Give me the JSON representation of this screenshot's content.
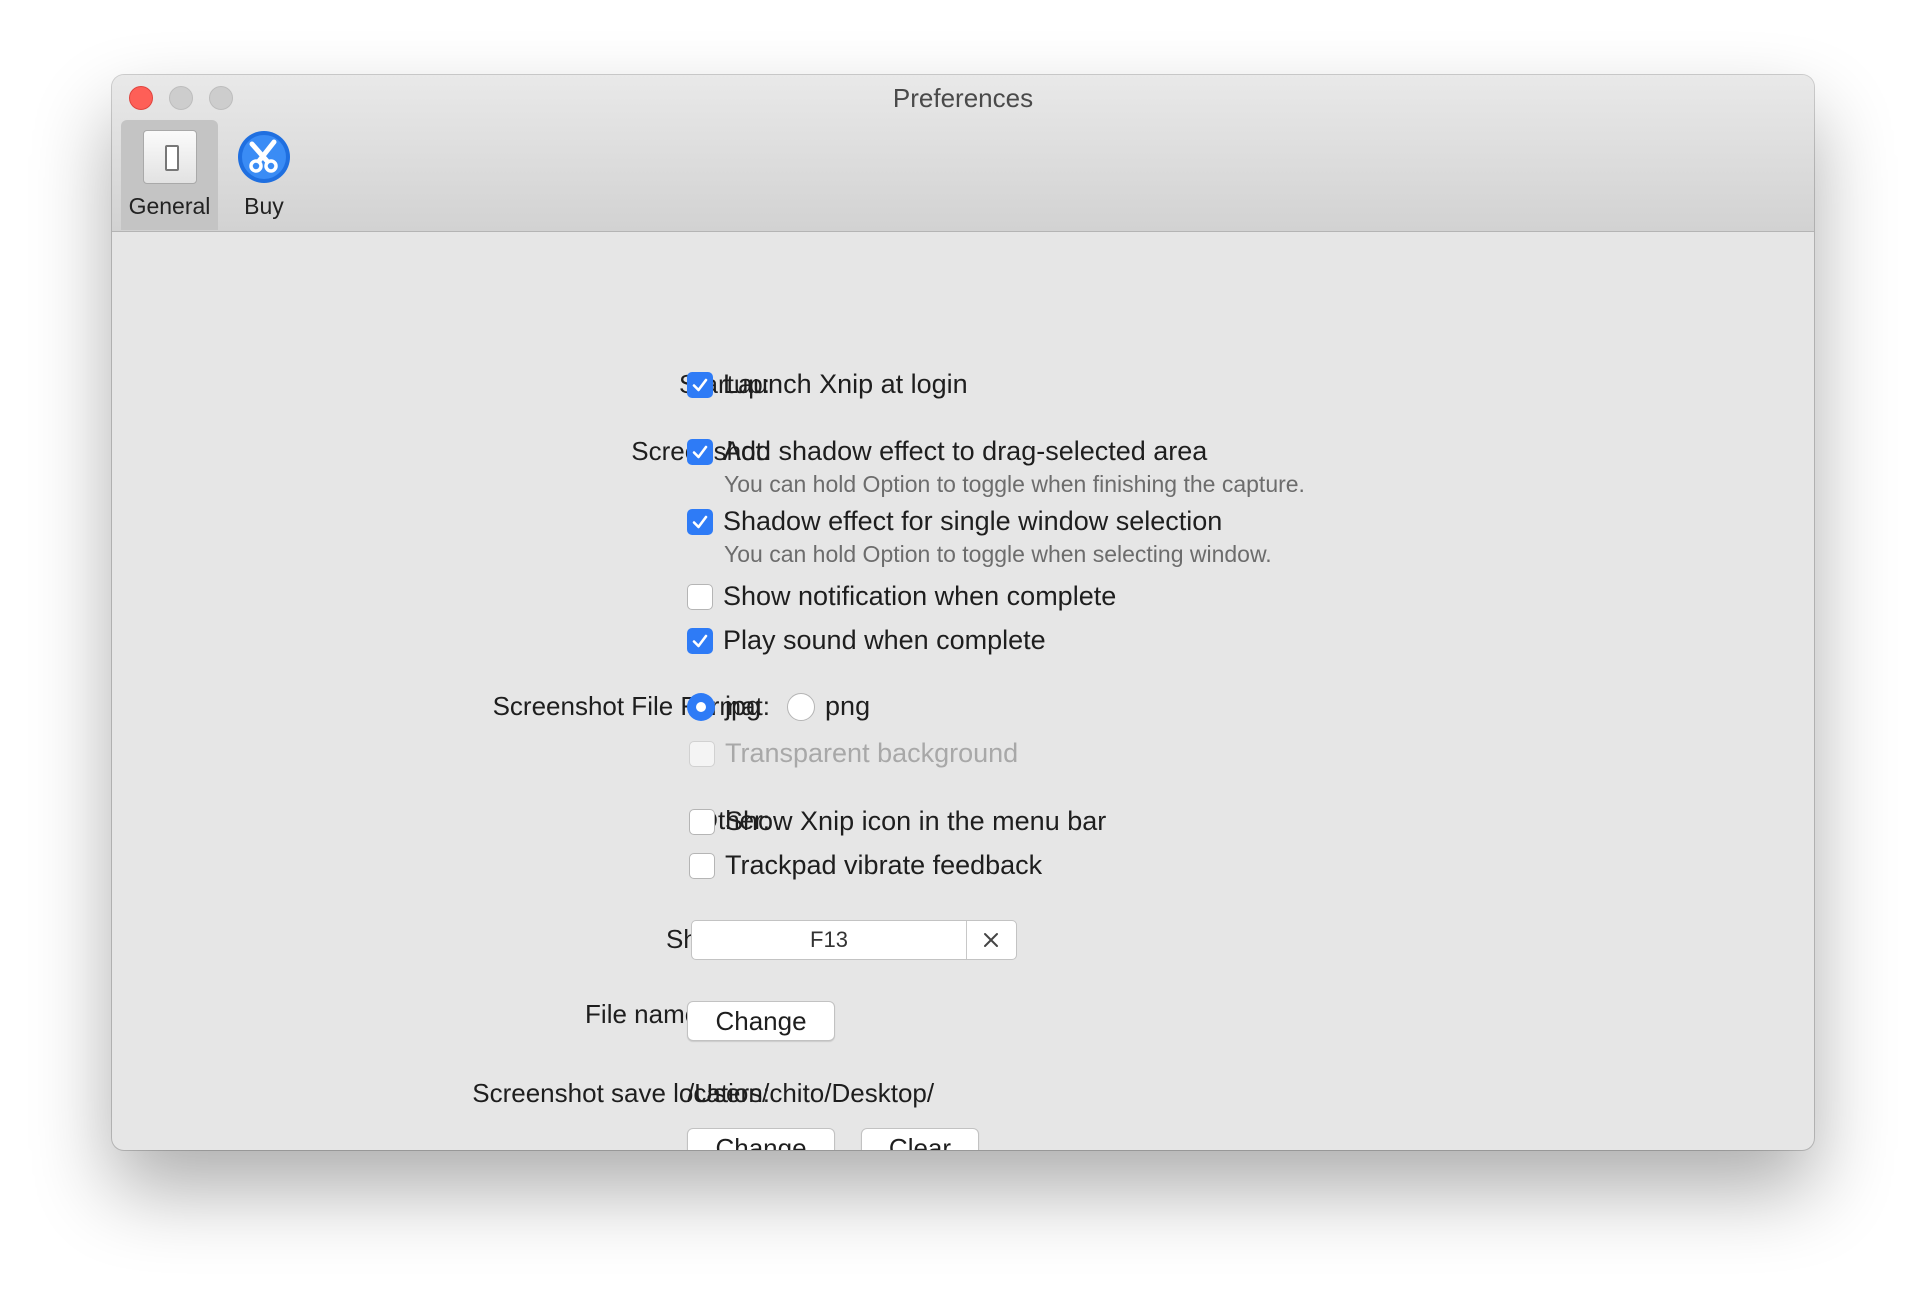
{
  "window": {
    "title": "Preferences",
    "tabs": [
      {
        "label": "General",
        "icon": "switch-icon",
        "selected": true
      },
      {
        "label": "Buy",
        "icon": "xnip-logo-icon",
        "selected": false
      }
    ]
  },
  "startup": {
    "label": "Startup:",
    "launch_at_login": {
      "label": "Launch Xnip at login",
      "checked": true
    }
  },
  "screenshot": {
    "label": "Screenshot:",
    "shadow_drag": {
      "label": "Add shadow effect to drag-selected area",
      "checked": true,
      "hint": "You can hold Option to toggle when finishing the capture."
    },
    "shadow_window": {
      "label": "Shadow effect for single window selection",
      "checked": true,
      "hint": "You can hold Option to toggle when selecting window."
    },
    "show_notification": {
      "label": "Show notification when complete",
      "checked": false
    },
    "play_sound": {
      "label": "Play sound when complete",
      "checked": true
    }
  },
  "file_format": {
    "label": "Screenshot File Format:",
    "options": [
      {
        "label": "jpg",
        "selected": true
      },
      {
        "label": "png",
        "selected": false
      }
    ],
    "transparent_background": {
      "label": "Transparent background",
      "checked": false,
      "enabled": false
    }
  },
  "other": {
    "label": "Other:",
    "menu_bar_icon": {
      "label": "Show Xnip icon in the menu bar",
      "checked": false
    },
    "trackpad_feedback": {
      "label": "Trackpad vibrate feedback",
      "checked": false
    }
  },
  "shortcut": {
    "label": "Shortcut:",
    "value": "F13"
  },
  "file_name_rules": {
    "label": "File name rules:",
    "change_button": "Change"
  },
  "save_location": {
    "label": "Screenshot save location:",
    "path": "/Users/chito/Desktop/",
    "change_button": "Change",
    "clear_button": "Clear"
  },
  "colors": {
    "accent": "#2e7bf6",
    "close": "#fe5f57"
  }
}
